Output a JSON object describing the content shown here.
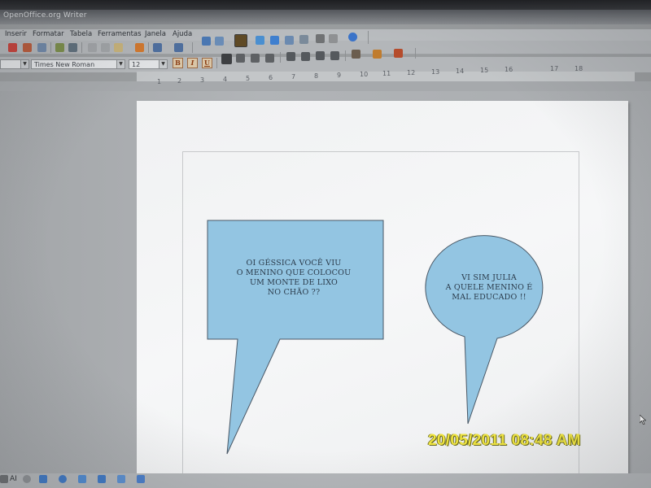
{
  "window": {
    "title": "OpenOffice.org Writer"
  },
  "menubar": {
    "items": [
      "Inserir",
      "Formatar",
      "Tabela",
      "Ferramentas",
      "Janela",
      "Ajuda"
    ]
  },
  "formatting": {
    "paragraph_style": "",
    "font_name": "Times New Roman",
    "font_size": "12",
    "bold_label": "B",
    "italic_label": "I",
    "underline_label": "U"
  },
  "ruler": {
    "ticks": [
      "1",
      "2",
      "3",
      "4",
      "5",
      "6",
      "7",
      "8",
      "9",
      "10",
      "11",
      "12",
      "13",
      "14",
      "15",
      "16",
      "17",
      "18"
    ]
  },
  "document": {
    "bubble_left": {
      "lines": [
        "OI GÉSSICA VOCÊ VIU",
        "O MENINO QUE COLOCOU",
        "UM MONTE DE LIXO",
        "NO CHÃO ??"
      ],
      "fill": "#93c5e2"
    },
    "bubble_right": {
      "lines": [
        "VI SIM JULIA",
        "A QUELE MENINO É",
        "MAL EDUCADO !!"
      ],
      "fill": "#93c5e2"
    }
  },
  "camera": {
    "timestamp": "20/05/2011 08:48 AM",
    "timestamp_color": "#f1e640"
  },
  "drawing_toolbar": {
    "text_tool": "AI"
  }
}
